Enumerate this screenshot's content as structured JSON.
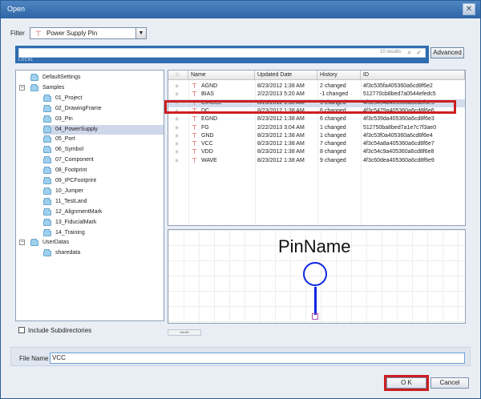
{
  "window": {
    "title": "Open",
    "close_glyph": "✕"
  },
  "filter": {
    "label": "Filter",
    "value": "Power Supply Pin",
    "icon": "pin-icon"
  },
  "search": {
    "results": "10 results",
    "local": "LOCAL",
    "advanced": "Advanced"
  },
  "tree": [
    {
      "label": "DefaultSettings",
      "level": 0,
      "toggle": ""
    },
    {
      "label": "Samples",
      "level": 0,
      "toggle": "−"
    },
    {
      "label": "01_Project",
      "level": 1,
      "toggle": ""
    },
    {
      "label": "02_DrawingFrame",
      "level": 1,
      "toggle": ""
    },
    {
      "label": "03_Pin",
      "level": 1,
      "toggle": ""
    },
    {
      "label": "04_PowerSupply",
      "level": 1,
      "toggle": "",
      "selected": true
    },
    {
      "label": "05_Port",
      "level": 1,
      "toggle": ""
    },
    {
      "label": "06_Symbol",
      "level": 1,
      "toggle": ""
    },
    {
      "label": "07_Component",
      "level": 1,
      "toggle": ""
    },
    {
      "label": "08_Footprint",
      "level": 1,
      "toggle": ""
    },
    {
      "label": "09_IPCFootprint",
      "level": 1,
      "toggle": ""
    },
    {
      "label": "10_Jumper",
      "level": 1,
      "toggle": ""
    },
    {
      "label": "11_TestLand",
      "level": 1,
      "toggle": ""
    },
    {
      "label": "12_AlignmentMark",
      "level": 1,
      "toggle": ""
    },
    {
      "label": "13_FiducialMark",
      "level": 1,
      "toggle": ""
    },
    {
      "label": "14_Training",
      "level": 1,
      "toggle": ""
    },
    {
      "label": "UserDatas",
      "level": 0,
      "toggle": "−"
    },
    {
      "label": "sharedata",
      "level": 1,
      "toggle": ""
    }
  ],
  "include_subdirectories": "Include Subdirectories",
  "table": {
    "columns": [
      "☆",
      "Name",
      "Updated Date",
      "History",
      "ID"
    ],
    "rows": [
      {
        "name": "AGND",
        "date": "8/23/2012 1:38 AM",
        "history": "2 changed",
        "id": "4f3c535fa405360a6cd8f6e2"
      },
      {
        "name": "BIAS",
        "date": "2/22/2013 5:20 AM",
        "history": "-1 changed",
        "id": "512770cb8bed7a0544efedc5"
      },
      {
        "name": "CIRCLE",
        "date": "8/23/2012 1:38 AM",
        "history": "5 changed",
        "id": "4f3c5454a405360a6cd8f6e5",
        "selected": true
      },
      {
        "name": "DC",
        "date": "8/23/2012 1:38 AM",
        "history": "6 changed",
        "id": "4f3c5479a405360a6cd8f6e6"
      },
      {
        "name": "EGND",
        "date": "8/23/2012 1:38 AM",
        "history": "6 changed",
        "id": "4f3c539da405360a6cd8f6e3"
      },
      {
        "name": "FG",
        "date": "2/22/2013 3:04 AM",
        "history": "1 changed",
        "id": "512750ba8bed7a1e7c7f3ae0"
      },
      {
        "name": "GND",
        "date": "8/23/2012 1:38 AM",
        "history": "1 changed",
        "id": "4f3c53f0a405360a6cd8f6e4"
      },
      {
        "name": "VCC",
        "date": "8/23/2012 1:38 AM",
        "history": "7 changed",
        "id": "4f3c54a8a405360a6cd8f6e7"
      },
      {
        "name": "VDD",
        "date": "8/23/2012 1:38 AM",
        "history": "8 changed",
        "id": "4f3c54c9a405360a6cd8f6e8"
      },
      {
        "name": "WAVE",
        "date": "8/23/2012 1:38 AM",
        "history": "9 changed",
        "id": "4f3c60dea405360a6cd8f6e9"
      }
    ]
  },
  "preview": {
    "pin_name": "PinName"
  },
  "scroll": {
    "label": "◂◂ ▸▸"
  },
  "file_name": {
    "label": "File Name",
    "value": "VCC"
  },
  "buttons": {
    "ok": "O K",
    "cancel": "Cancel"
  },
  "colors": {
    "highlight": "#cc1f1f",
    "pin_blue": "#0d26e0",
    "titlebar": "#2d65a5"
  }
}
